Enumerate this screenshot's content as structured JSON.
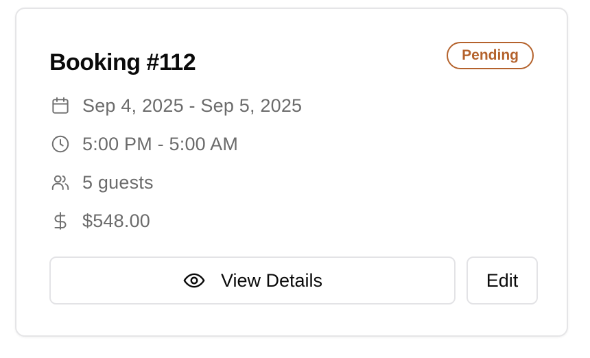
{
  "booking": {
    "title": "Booking #112",
    "status": "Pending",
    "status_color": "#b4622c",
    "dates": "Sep 4, 2025 - Sep 5, 2025",
    "times": "5:00 PM - 5:00 AM",
    "guests": "5 guests",
    "price": "$548.00"
  },
  "icons": {
    "dates": "calendar-icon",
    "times": "clock-icon",
    "guests": "users-icon",
    "price": "dollar-icon",
    "view": "eye-icon"
  },
  "actions": {
    "view_label": "View Details",
    "edit_label": "Edit"
  }
}
